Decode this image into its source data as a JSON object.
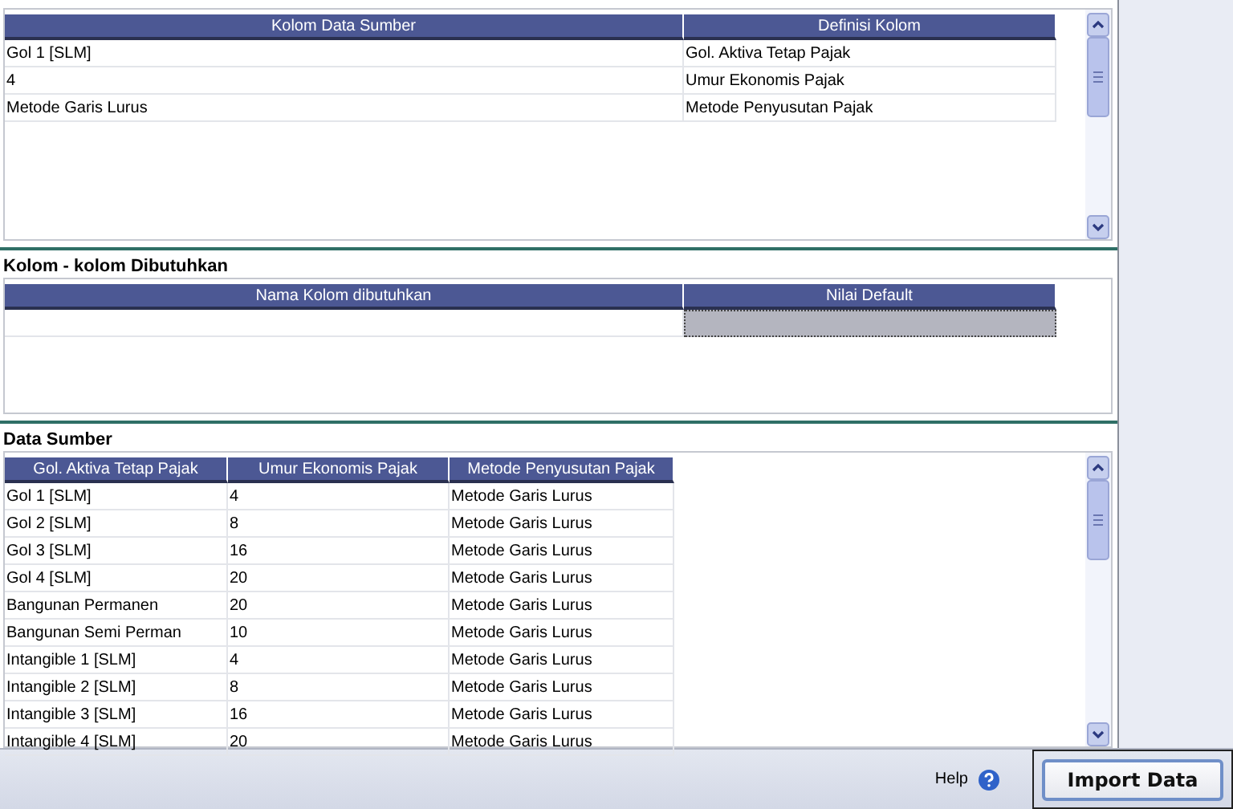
{
  "mapping_table": {
    "columns": [
      "Kolom Data Sumber",
      "Definisi Kolom"
    ],
    "rows": [
      [
        "Gol 1 [SLM]",
        "Gol. Aktiva Tetap Pajak"
      ],
      [
        "4",
        "Umur Ekonomis Pajak"
      ],
      [
        "Metode Garis Lurus",
        "Metode Penyusutan Pajak"
      ]
    ]
  },
  "required_section": {
    "title": "Kolom - kolom Dibutuhkan",
    "columns": [
      "Nama Kolom dibutuhkan",
      "Nilai Default"
    ],
    "rows": [
      {
        "default_selected": true
      }
    ]
  },
  "source_section": {
    "title": "Data Sumber",
    "columns": [
      "Gol. Aktiva Tetap Pajak",
      "Umur Ekonomis Pajak",
      "Metode Penyusutan Pajak"
    ],
    "rows": [
      [
        "Gol 1 [SLM]",
        "4",
        "Metode Garis Lurus"
      ],
      [
        "Gol 2 [SLM]",
        "8",
        "Metode Garis Lurus"
      ],
      [
        "Gol 3 [SLM]",
        "16",
        "Metode Garis Lurus"
      ],
      [
        "Gol 4 [SLM]",
        "20",
        "Metode Garis Lurus"
      ],
      [
        "Bangunan Permanen",
        "20",
        "Metode Garis Lurus"
      ],
      [
        "Bangunan Semi Perman",
        "10",
        "Metode Garis Lurus"
      ],
      [
        "Intangible 1 [SLM]",
        "4",
        "Metode Garis Lurus"
      ],
      [
        "Intangible 2 [SLM]",
        "8",
        "Metode Garis Lurus"
      ],
      [
        "Intangible 3 [SLM]",
        "16",
        "Metode Garis Lurus"
      ],
      [
        "Intangible 4 [SLM]",
        "20",
        "Metode Garis Lurus"
      ]
    ]
  },
  "footer": {
    "help_label": "Help",
    "import_button": "Import Data"
  }
}
